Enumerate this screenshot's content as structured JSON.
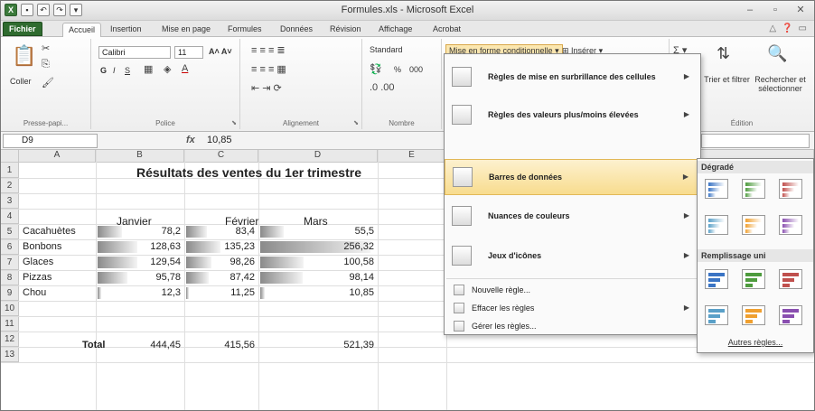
{
  "window": {
    "title": "Formules.xls - Microsoft Excel",
    "quick_access": [
      "X",
      "save-icon",
      "undo-icon",
      "redo-icon"
    ]
  },
  "tabs": [
    {
      "label": "Fichier"
    },
    {
      "label": "Accueil"
    },
    {
      "label": "Insertion"
    },
    {
      "label": "Mise en page"
    },
    {
      "label": "Formules"
    },
    {
      "label": "Données"
    },
    {
      "label": "Révision"
    },
    {
      "label": "Affichage"
    },
    {
      "label": "Acrobat"
    }
  ],
  "ribbon": {
    "clipboard": {
      "paste_label": "Coller",
      "group_label": "Presse-papi..."
    },
    "font": {
      "name": "Calibri",
      "size": "11",
      "bold": "G",
      "italic": "I",
      "underline": "S",
      "group_label": "Police"
    },
    "alignment": {
      "group_label": "Alignement"
    },
    "number": {
      "format": "Standard",
      "percent": "%",
      "thousands": "000",
      "group_label": "Nombre"
    },
    "styles": {
      "conditional_formatting": "Mise en forme conditionnelle"
    },
    "cells": {
      "insert": "Insérer"
    },
    "editing": {
      "sort_filter": "Trier et filtrer",
      "find_select": "Rechercher et sélectionner",
      "group_label": "Édition"
    }
  },
  "formula_bar": {
    "cell_ref": "D9",
    "fx": "fx",
    "value": "10,85"
  },
  "grid": {
    "columns": [
      "A",
      "B",
      "C",
      "D",
      "E"
    ],
    "rows": [
      "1",
      "2",
      "3",
      "4",
      "5",
      "6",
      "7",
      "8",
      "9",
      "10",
      "11",
      "12",
      "13"
    ],
    "title": "Résultats des ventes du 1er trimestre",
    "headers": [
      "Janvier",
      "Février",
      "Mars"
    ],
    "data": [
      {
        "label": "Cacahuètes",
        "values": [
          "78,2",
          "83,4",
          "55,5"
        ]
      },
      {
        "label": "Bonbons",
        "values": [
          "128,63",
          "135,23",
          "256,32"
        ]
      },
      {
        "label": "Glaces",
        "values": [
          "129,54",
          "98,26",
          "100,58"
        ]
      },
      {
        "label": "Pizzas",
        "values": [
          "95,78",
          "87,42",
          "98,14"
        ]
      },
      {
        "label": "Chou",
        "values": [
          "12,3",
          "11,25",
          "10,85"
        ]
      }
    ],
    "total": {
      "label": "Total",
      "values": [
        "444,45",
        "415,56",
        "521,39"
      ]
    },
    "databar_max": 256.32
  },
  "menu": {
    "items": [
      {
        "label": "Règles de mise en surbrillance des cellules"
      },
      {
        "label": "Règles des valeurs plus/moins élevées"
      },
      {
        "label": "Barres de données"
      },
      {
        "label": "Nuances de couleurs"
      },
      {
        "label": "Jeux d'icônes"
      }
    ],
    "small": [
      {
        "label": "Nouvelle règle..."
      },
      {
        "label": "Effacer les règles"
      },
      {
        "label": "Gérer les règles..."
      }
    ]
  },
  "submenu": {
    "gradient_heading": "Dégradé",
    "solid_heading": "Remplissage uni",
    "more": "Autres règles...",
    "colors": [
      "#3a74c4",
      "#4e9b3e",
      "#c0504d",
      "#5aa0c8",
      "#f0a030",
      "#8a4fb0"
    ]
  },
  "accent": {
    "file_tab": "#2f6b2f",
    "highlight": "#f8dc8e",
    "databar": "#8a8a8a"
  }
}
